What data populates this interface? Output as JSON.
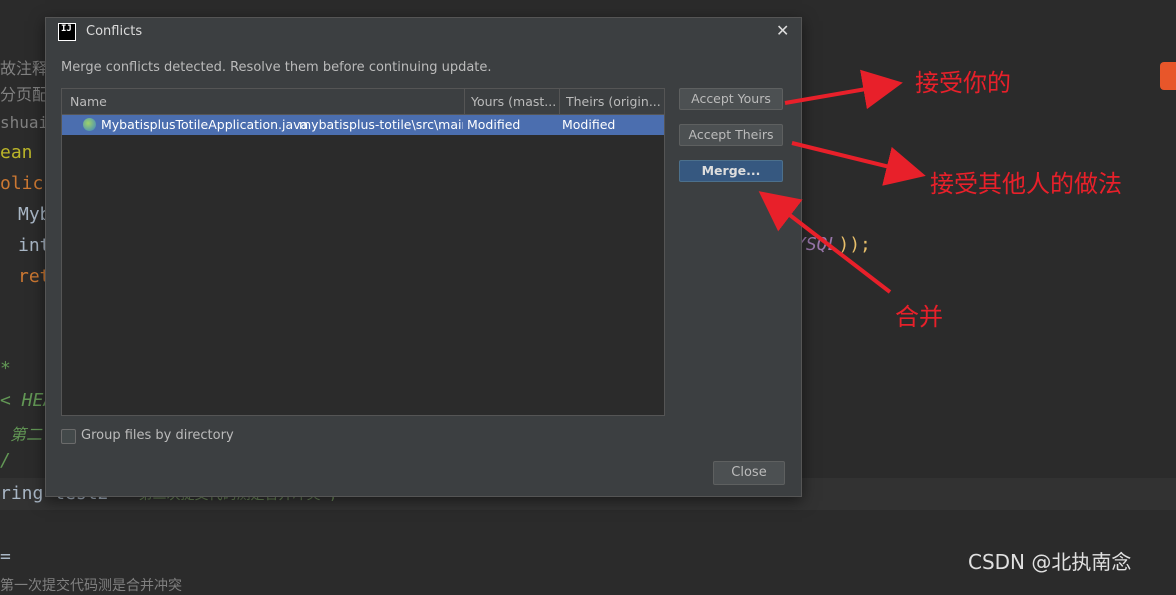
{
  "editor": {
    "line1": "故注释",
    "line2": "分页配",
    "line3": "shuai",
    "line4": "ean",
    "line5": "olic",
    "line6": "Myb",
    "line7": "int",
    "line8": "ret",
    "line9": "*",
    "line10": "< HEA",
    "line11": "第二",
    "line12": "/",
    "line13a": "ring test2=",
    "line13b": "\"第二次提交代码测是合并冲突\";",
    "line14": "=",
    "line15": "第一次提交代码测是合并冲突",
    "tail_a": "YSQL",
    "tail_b": "));"
  },
  "dialog": {
    "title": "Conflicts",
    "message": "Merge conflicts detected. Resolve them before continuing update.",
    "columns": [
      "Name",
      "Yours (mast...",
      "Theirs (origin..."
    ],
    "rows": [
      {
        "file": "MybatisplusTotileApplication.java",
        "path": "mybatisplus-totile\\src\\main\\",
        "yours": "Modified",
        "theirs": "Modified"
      }
    ],
    "buttons": {
      "accept_yours": "Accept Yours",
      "accept_theirs": "Accept Theirs",
      "merge": "Merge..."
    },
    "group_by_directory": "Group files by directory",
    "close": "Close"
  },
  "annotations": {
    "accept_yours": "接受你的",
    "accept_theirs": "接受其他人的做法",
    "merge": "合并"
  },
  "watermark": "CSDN @北执南念",
  "colors": {
    "accent": "#365880",
    "selection": "#4b6eaf",
    "annotation": "#e8202a"
  }
}
